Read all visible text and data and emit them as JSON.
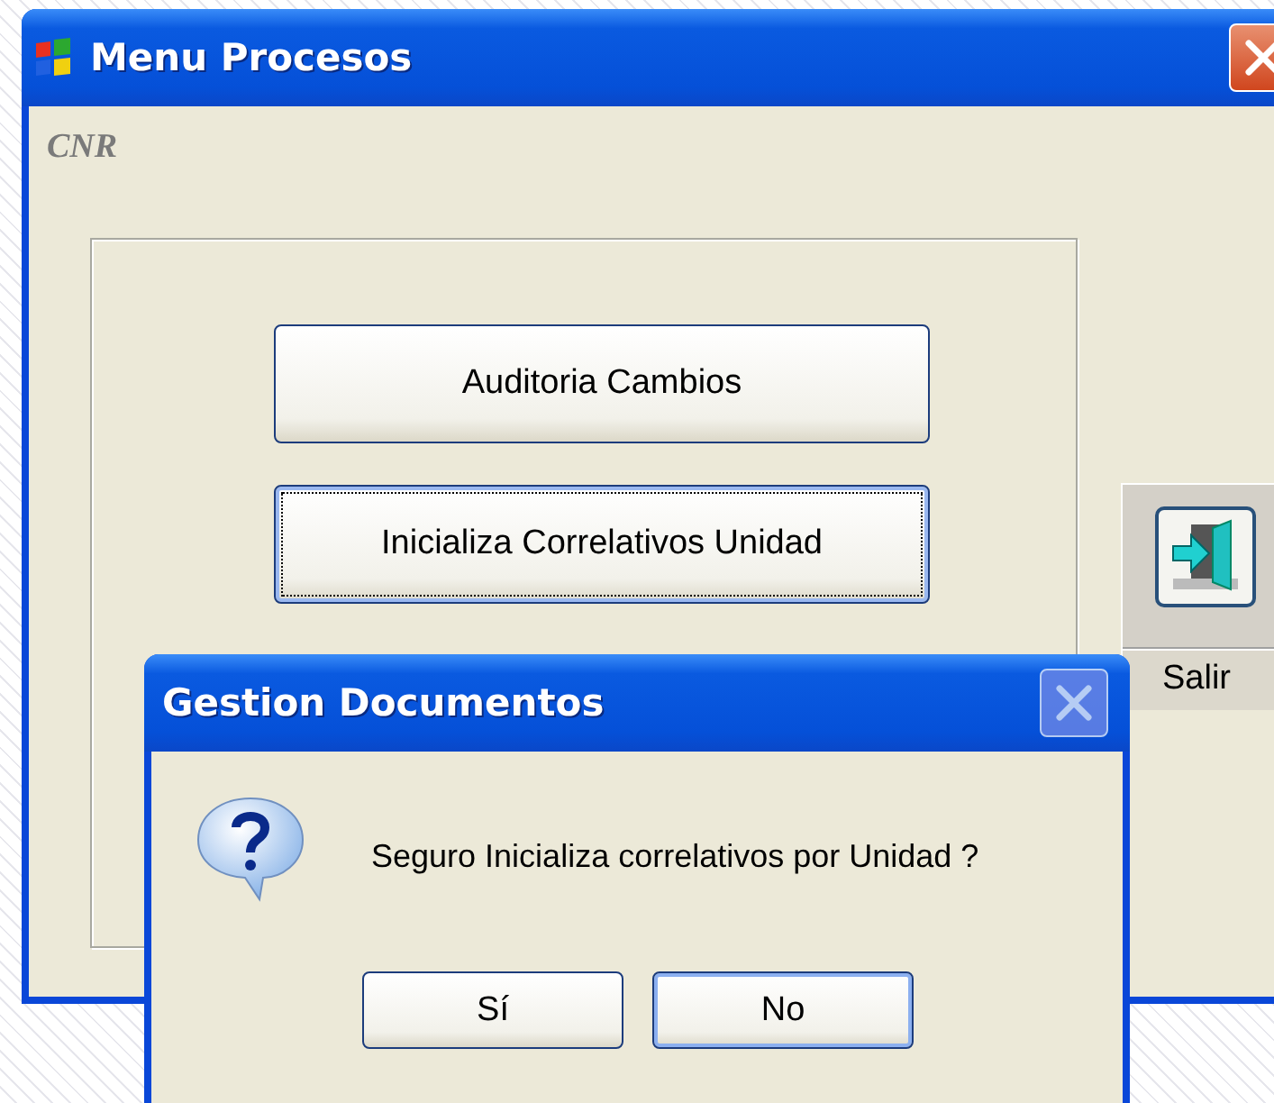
{
  "window": {
    "title": "Menu Procesos"
  },
  "company_label": "CNR",
  "menu_buttons": [
    {
      "label": "Auditoria Cambios",
      "focused": false
    },
    {
      "label": "Inicializa Correlativos Unidad",
      "focused": true
    }
  ],
  "toolbar": {
    "exit_label": "Salir"
  },
  "dialog": {
    "title": "Gestion Documentos",
    "close_disabled": true,
    "message": "Seguro Inicializa correlativos por Unidad ?",
    "buttons": [
      {
        "label": "Sí",
        "default": false
      },
      {
        "label": "No",
        "default": true
      }
    ]
  }
}
